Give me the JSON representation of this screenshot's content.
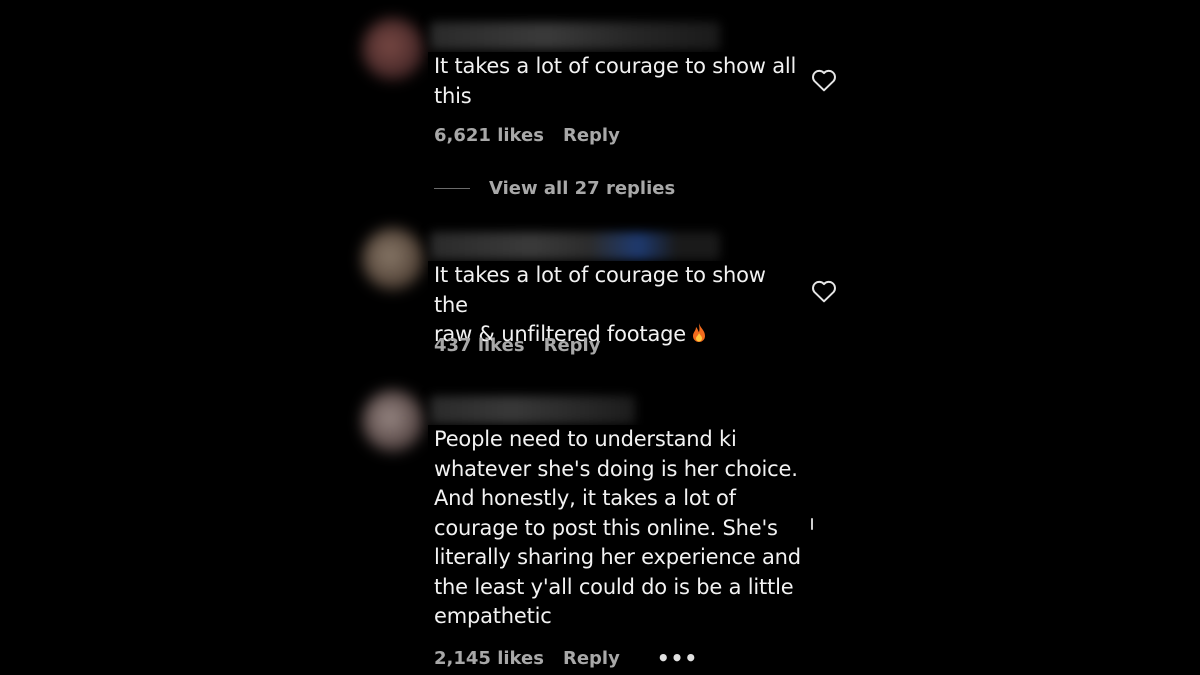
{
  "comments": [
    {
      "text": "It takes a lot of courage to show all\nthis",
      "likes": "6,621 likes",
      "reply_label": "Reply",
      "view_replies": "View all 27 replies"
    },
    {
      "text": "It takes a lot of courage to show the\nraw & unfiltered footage",
      "likes": "437 likes",
      "reply_label": "Reply"
    },
    {
      "text": "People need to understand ki\nwhatever she's doing is her choice.\nAnd honestly, it takes a lot of\ncourage to post this online. She's\nliterally sharing her experience and\nthe least y'all could do is be a little\nempathetic",
      "likes": "2,145 likes",
      "reply_label": "Reply",
      "more_label": "•••"
    }
  ],
  "icons": {
    "like": "heart-outline-icon",
    "emoji": "fire-emoji-icon",
    "more": "more-options-icon"
  },
  "colors": {
    "background": "#000000",
    "primary_text": "#f2f2f2",
    "secondary_text": "#a8a8a8"
  }
}
